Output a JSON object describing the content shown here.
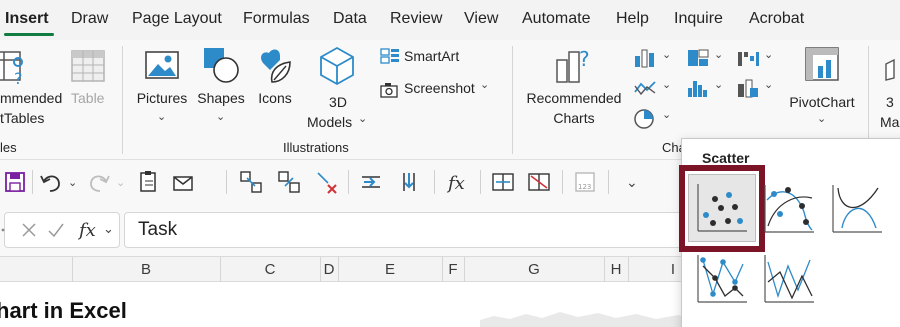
{
  "tabs": [
    "Insert",
    "Draw",
    "Page Layout",
    "Formulas",
    "Data",
    "Review",
    "View",
    "Automate",
    "Help",
    "Inquire",
    "Acrobat"
  ],
  "ribbon": {
    "recommended_pivot_line1": "mmended",
    "recommended_pivot_line2": "tTables",
    "table_label": "Table",
    "pictures_label": "Pictures",
    "shapes_label": "Shapes",
    "icons_label": "Icons",
    "models_label_line1": "3D",
    "models_label_line2": "Models",
    "smartart_label": "SmartArt",
    "screenshot_label": "Screenshot",
    "recommended_charts_line1": "Recommended",
    "recommended_charts_line2": "Charts",
    "pivotchart_label": "PivotChart",
    "trailing_line1": "3",
    "trailing_line2": "Ma",
    "groups": {
      "tables": "les",
      "illustrations": "Illustrations",
      "charts": "Cha"
    }
  },
  "formula_bar": {
    "value": "Task"
  },
  "columns": [
    "B",
    "C",
    "D",
    "E",
    "F",
    "G",
    "H",
    "I"
  ],
  "sheet": {
    "title_fragment": "hart in Excel"
  },
  "scatter_panel": {
    "title": "Scatter"
  },
  "colors": {
    "accent_green": "#107c41",
    "highlight_border": "#7b1427",
    "chart_blue": "#2e8bc9"
  }
}
